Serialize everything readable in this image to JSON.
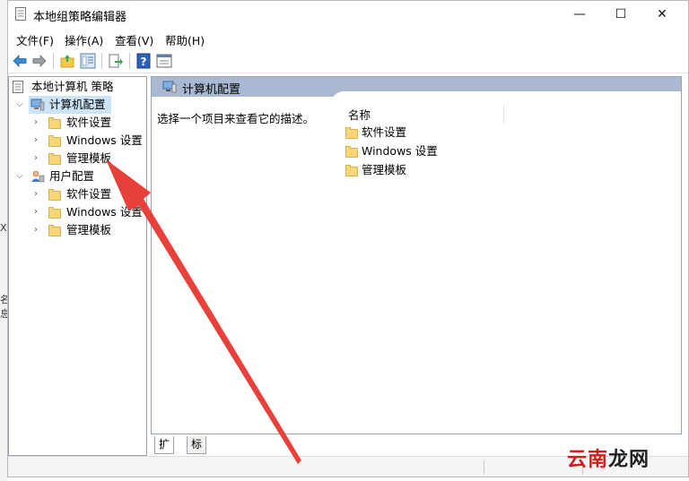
{
  "window": {
    "title": "本地组策略编辑器"
  },
  "window_controls": {
    "minimize": "—",
    "maximize": "☐",
    "close": "✕"
  },
  "menu": [
    "文件(F)",
    "操作(A)",
    "查看(V)",
    "帮助(H)"
  ],
  "tree": {
    "root": "本地计算机 策略",
    "computer": {
      "label": "计算机配置",
      "children": [
        "软件设置",
        "Windows 设置",
        "管理模板"
      ]
    },
    "user": {
      "label": "用户配置",
      "children": [
        "软件设置",
        "Windows 设置",
        "管理模板"
      ]
    }
  },
  "right_pane": {
    "title": "计算机配置",
    "description": "选择一个项目来查看它的描述。",
    "column_name": "名称",
    "items": [
      "软件设置",
      "Windows 设置",
      "管理模板"
    ]
  },
  "tabs": [
    "扩展",
    "标准"
  ],
  "watermark": {
    "part1": "云南",
    "part2": "龙网"
  },
  "colors": {
    "pane_header": "#a8b9d1",
    "arrow": "#e8403a",
    "folder": "#f7d77a",
    "selection": "#cce4f7"
  },
  "desktop_fragments": [
    "X",
    "名",
    "息"
  ]
}
